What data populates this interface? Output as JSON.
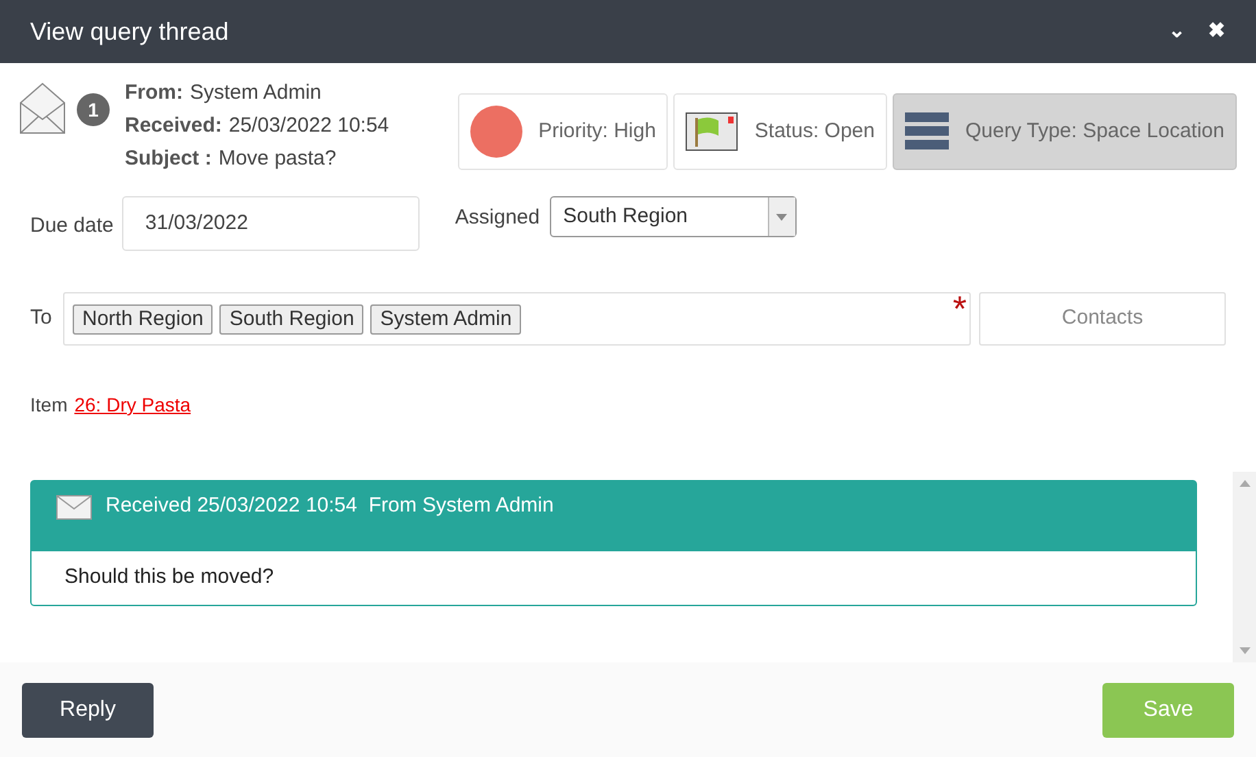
{
  "window": {
    "title": "View query thread",
    "buttons": [
      "⌄",
      "✖"
    ]
  },
  "header": {
    "count": "1",
    "fields": [
      {
        "label": "From:",
        "value": "System Admin"
      },
      {
        "label": "Received:",
        "value": "25/03/2022 10:54"
      },
      {
        "label": "Subject :",
        "value": "Move pasta?"
      }
    ]
  },
  "chips": [
    {
      "kind": "priority",
      "label": "Priority: High",
      "color": "#ec6f62",
      "selected": false
    },
    {
      "kind": "status",
      "label": "Status: Open",
      "selected": false
    },
    {
      "kind": "type",
      "label": "Query Type: Space Location",
      "selected": true
    }
  ],
  "due_date": {
    "label": "Due date",
    "value": "31/03/2022"
  },
  "assigned": {
    "label": "Assigned",
    "value": "South Region"
  },
  "to": {
    "label": "To",
    "recipients": [
      "North Region",
      "South Region",
      "System Admin"
    ],
    "required_mark": "*"
  },
  "contacts_button": "Contacts",
  "item": {
    "label": "Item",
    "link": "26: Dry Pasta"
  },
  "messages": [
    {
      "header": "Received 25/03/2022 10:54  From System Admin",
      "body": "Should this be moved?"
    }
  ],
  "footer": {
    "reply": "Reply",
    "save": "Save"
  }
}
